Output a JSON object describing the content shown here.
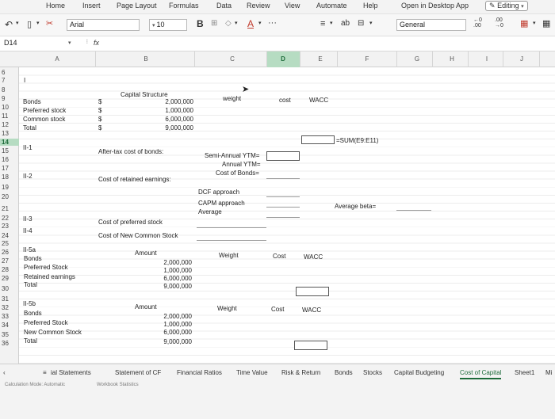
{
  "menu": {
    "items": [
      "Home",
      "Insert",
      "Page Layout",
      "Formulas",
      "Data",
      "Review",
      "View",
      "Automate",
      "Help"
    ],
    "open_desktop_label": "Open in Desktop App",
    "editing_label": "Editing"
  },
  "toolbar": {
    "font_name": "Arial",
    "font_size": "10",
    "bold_label": "B",
    "more_label": "···",
    "number_format": "General"
  },
  "formula_bar": {
    "name_box": "D14",
    "fx_label": "fx",
    "formula": ""
  },
  "columns": [
    "A",
    "B",
    "C",
    "D",
    "E",
    "F",
    "G",
    "H",
    "I",
    "J"
  ],
  "rows": [
    "6",
    "7",
    "8",
    "9",
    "10",
    "11",
    "12",
    "13",
    "14",
    "15",
    "16",
    "17",
    "18",
    "19",
    "20",
    "21",
    "22",
    "23",
    "24",
    "25",
    "26",
    "27",
    "28",
    "29",
    "30",
    "31",
    "32",
    "33",
    "34",
    "35",
    "36"
  ],
  "cells": {
    "r7_a": "I",
    "capital_structure": "Capital Structure",
    "weight": "weight",
    "cost": "cost",
    "wacc": "WACC",
    "bonds": "Bonds",
    "preferred_stock": "Preferred stock",
    "common_stock": "Common stock",
    "total": "Total",
    "dollar": "$",
    "v_bonds": "2,000,000",
    "v_pref": "1,000,000",
    "v_common": "6,000,000",
    "v_total": "9,000,000",
    "sum_formula": "=SUM(E9:E11)",
    "ii1": "II-1",
    "after_tax_bonds": "After-tax cost of bonds:",
    "semi_annual_ytm": "Semi-Annual YTM=",
    "annual_ytm": "Annual YTM=",
    "cost_of_bonds": "Cost of Bonds=",
    "ii2": "II-2",
    "cost_retained": "Cost of retained earnings:",
    "dcf_approach": "DCF approach",
    "capm_approach": "CAPM approach",
    "average": "Average",
    "average_beta": "Average beta=",
    "ii3": "II-3",
    "cost_preferred": "Cost of preferred stock",
    "ii4": "II-4",
    "cost_new_common": "Cost of New Common Stock",
    "ii5a": "II-5a",
    "amount": "Amount",
    "weight_cap": "Weight",
    "cost_cap": "Cost",
    "bonds_b": "Bonds",
    "preferred_stock_b": "Preferred Stock",
    "retained_earnings": "Retained earnings",
    "total_b": "Total",
    "v_retained": "6,000,000",
    "ii5b": "II-5b",
    "new_common_stock": "New Common Stock",
    "v_new_common": "6,000,000"
  },
  "sheet_tabs": {
    "financial_statements": "ial Statements",
    "statement_cf": "Statement of CF",
    "financial_ratios": "Financial Ratios",
    "time_value": "Time Value",
    "risk_return": "Risk & Return",
    "bonds": "Bonds",
    "stocks": "Stocks",
    "capital_budgeting": "Capital Budgeting",
    "cost_of_capital": "Cost of Capital",
    "sheet1": "Sheet1",
    "more": "Mi"
  },
  "status": {
    "calc_mode": "Calculation Mode: Automatic",
    "workbook_stats": "Workbook Statistics"
  },
  "colors": {
    "accent_green": "#1d6b3a",
    "selected_header": "#b6dcc2"
  }
}
